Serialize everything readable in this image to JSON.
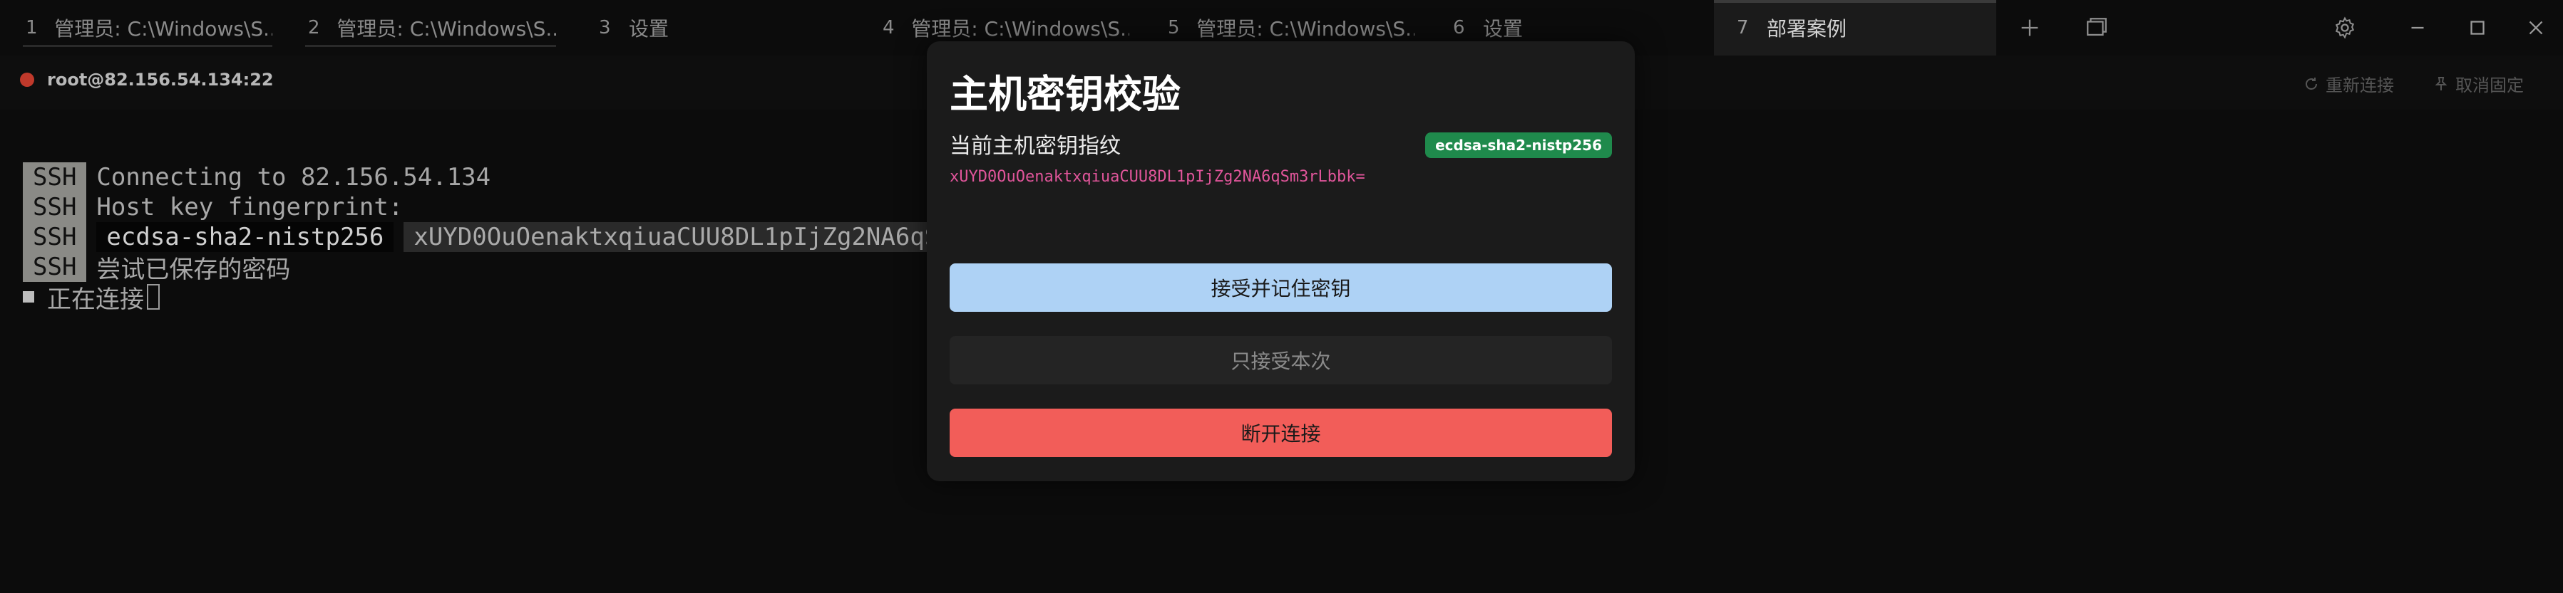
{
  "tabs": [
    {
      "num": "1",
      "title": "管理员: C:\\Windows\\S..."
    },
    {
      "num": "2",
      "title": "管理员: C:\\Windows\\S..."
    },
    {
      "num": "3",
      "title": "设置"
    },
    {
      "num": "4",
      "title": "管理员: C:\\Windows\\S..."
    },
    {
      "num": "5",
      "title": "管理员: C:\\Windows\\S..."
    },
    {
      "num": "6",
      "title": "设置"
    },
    {
      "num": "7",
      "title": "部署案例"
    }
  ],
  "session": {
    "host": "root@82.156.54.134:22",
    "reconnect_label": "重新连接",
    "unpin_label": "取消固定"
  },
  "terminal": {
    "ssh_tag": "SSH",
    "line1": "Connecting to 82.156.54.134",
    "line2": "Host key fingerprint:",
    "fp_algo": "ecdsa-sha2-nistp256",
    "fp_hash": "xUYD0OuOenaktxqiuaCUU8DL1pIjZg2NA6qSm3r",
    "line4": "尝试已保存的密码",
    "line5": "正在连接"
  },
  "dialog": {
    "title": "主机密钥校验",
    "fingerprint_label": "当前主机密钥指纹",
    "algo_badge": "ecdsa-sha2-nistp256",
    "fingerprint": "xUYD0OuOenaktxqiuaCUU8DL1pIjZg2NA6qSm3rLbbk=",
    "accept_remember": "接受并记住密钥",
    "accept_once": "只接受本次",
    "disconnect": "断开连接"
  },
  "colors": {
    "accent_blue": "#aed2f5",
    "danger_red": "#f25d59",
    "badge_green": "#1f8a4c",
    "fingerprint_pink": "#e0559a",
    "status_dot": "#c0392b"
  },
  "icons": [
    "plus-icon",
    "layers-icon",
    "gear-icon",
    "minimize-icon",
    "maximize-icon",
    "close-icon",
    "reconnect-icon",
    "pin-icon"
  ]
}
